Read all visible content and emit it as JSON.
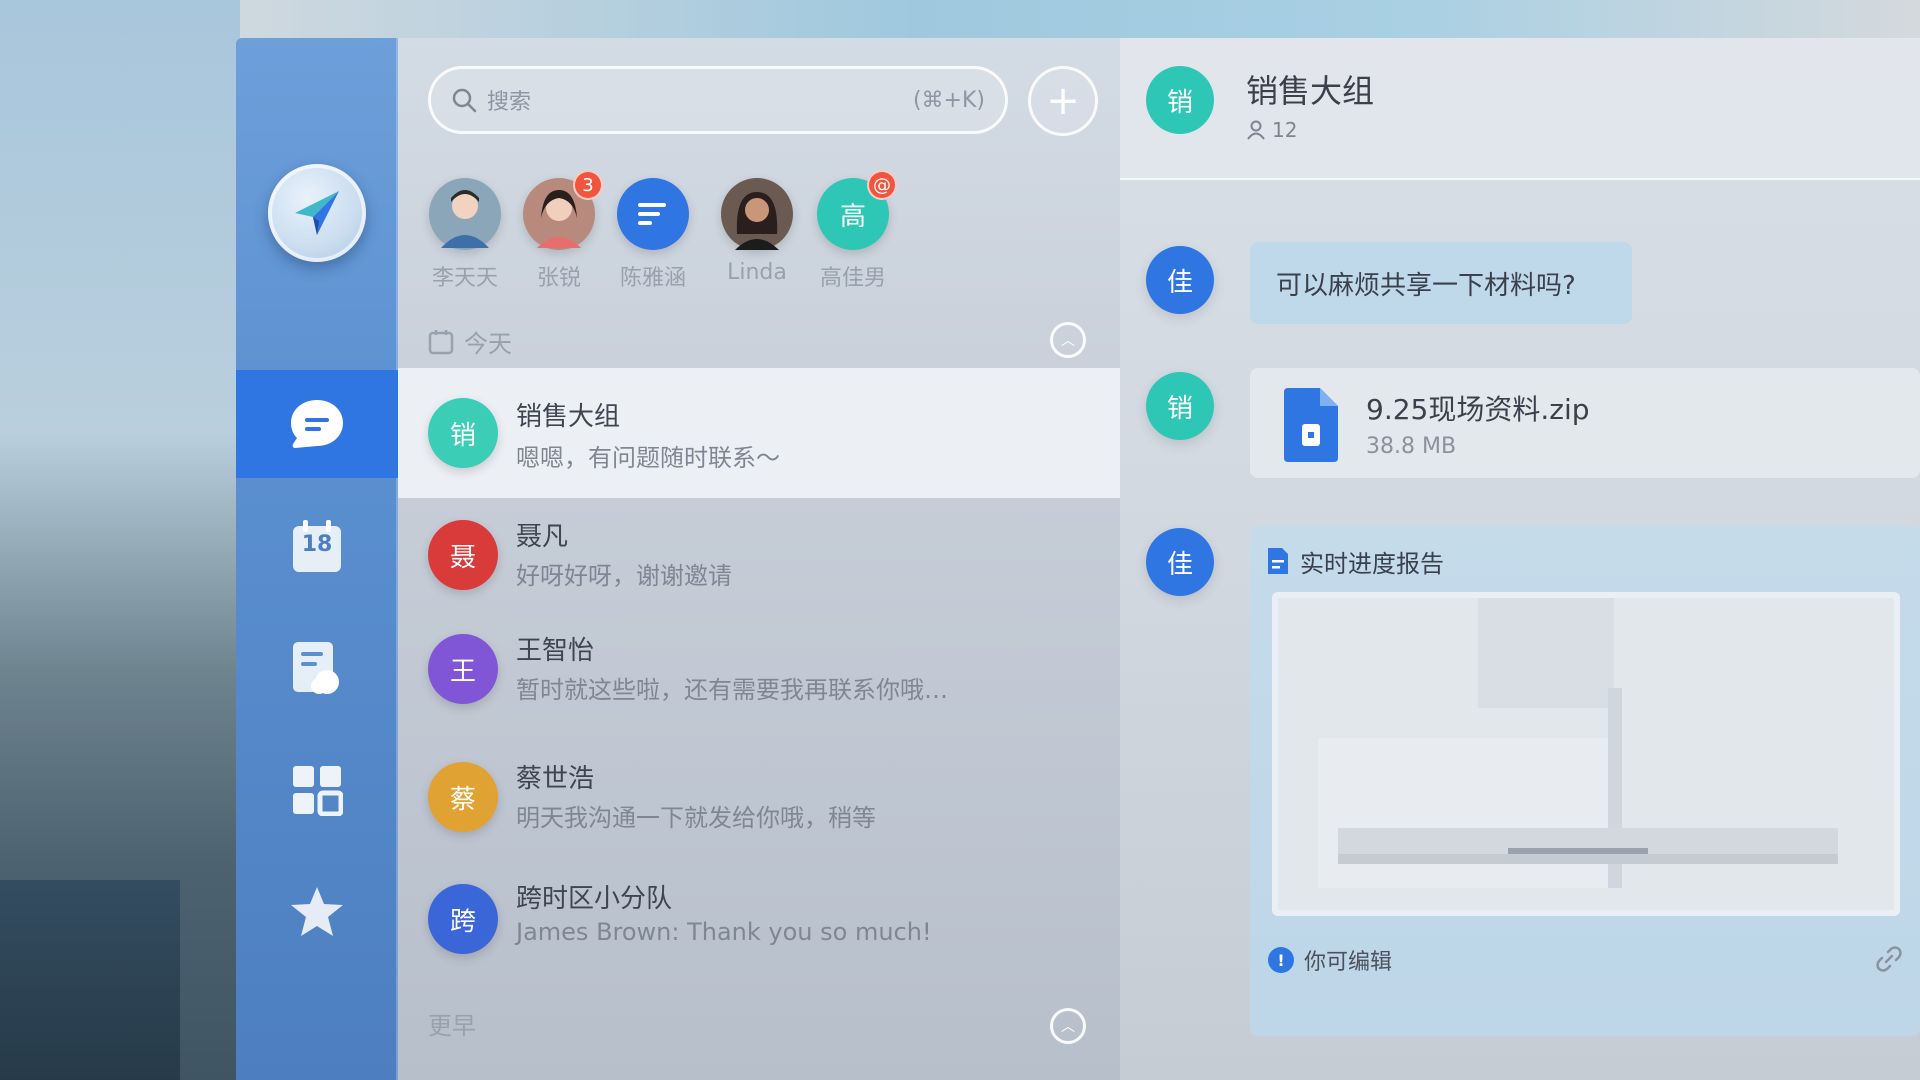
{
  "search": {
    "placeholder": "搜索",
    "shortcut": "(⌘+K)",
    "add_label": "+"
  },
  "stories": [
    {
      "name": "李天天",
      "initial": "",
      "color": "#8aa6b8"
    },
    {
      "name": "张锐",
      "initial": "",
      "color": "#b88a7e",
      "badge": "3"
    },
    {
      "name": "陈雅涵",
      "initial": "",
      "color": "#2f76e3"
    },
    {
      "name": "Linda",
      "initial": "",
      "color": "#6b5a52"
    },
    {
      "name": "高佳男",
      "initial": "高",
      "color": "#2ec7b6",
      "badge": "@"
    }
  ],
  "sections": {
    "today": "今天",
    "earlier": "更早"
  },
  "conversations": [
    {
      "title": "销售大组",
      "preview": "嗯嗯，有问题随时联系～",
      "initial": "销",
      "color": "#3ccdb6"
    },
    {
      "title": "聂凡",
      "preview": "好呀好呀，谢谢邀请",
      "initial": "聂",
      "color": "#d93a3a"
    },
    {
      "title": "王智怡",
      "preview": "暂时就这些啦，还有需要我再联系你哦…",
      "initial": "王",
      "color": "#8056d6"
    },
    {
      "title": "蔡世浩",
      "preview": "明天我沟通一下就发给你哦，稍等",
      "initial": "蔡",
      "color": "#e0a233"
    },
    {
      "title": "跨时区小分队",
      "preview": "James Brown: Thank you so much!",
      "initial": "跨",
      "color": "#3a66d8"
    }
  ],
  "chat": {
    "title": "销售大组",
    "member_count": "12",
    "header_initial": "销",
    "messages": [
      {
        "initial": "佳",
        "text": "可以麻烦共享一下材料吗?"
      },
      {
        "initial": "销",
        "file_name": "9.25现场资料.zip",
        "file_size": "38.8 MB"
      },
      {
        "initial": "佳",
        "doc_title": "实时进度报告",
        "doc_note": "你可编辑"
      }
    ]
  },
  "sidebar": {
    "calendar_day": "18"
  },
  "colors": {
    "accent": "#2f76e3",
    "teal": "#2ec7b6",
    "blue": "#2f76e3"
  }
}
